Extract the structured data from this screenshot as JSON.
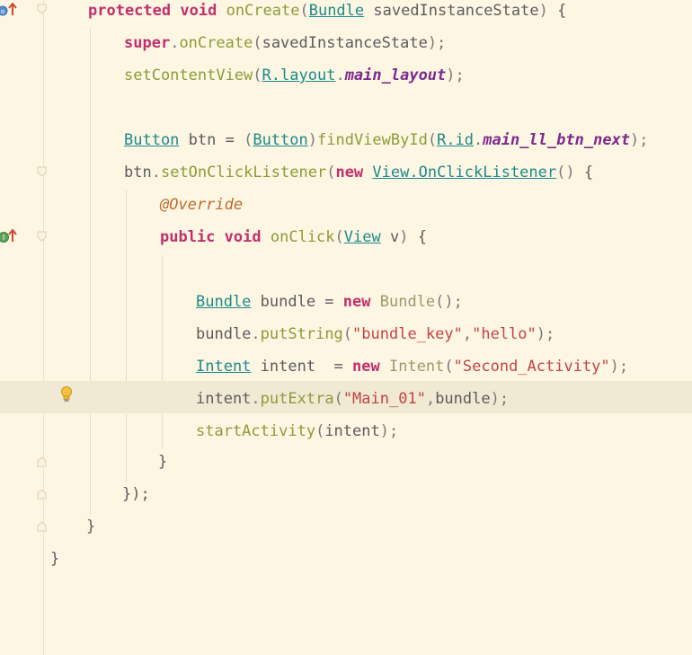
{
  "editor": {
    "lines": [
      {
        "id": "l1",
        "tokens": [
          [
            "kw",
            "protected"
          ],
          [
            "plain",
            " "
          ],
          [
            "kw",
            "void"
          ],
          [
            "plain",
            " "
          ],
          [
            "fn",
            "onCreate"
          ],
          [
            "pn",
            "("
          ],
          [
            "ty",
            "Bundle"
          ],
          [
            "plain",
            " savedInstanceState"
          ],
          [
            "pn",
            ")"
          ],
          [
            "plain",
            " {"
          ]
        ]
      },
      {
        "id": "l2",
        "tokens": [
          [
            "kw",
            "super"
          ],
          [
            "pn",
            "."
          ],
          [
            "fn",
            "onCreate"
          ],
          [
            "pn",
            "("
          ],
          [
            "plain",
            "savedInstanceState"
          ],
          [
            "pn",
            ");"
          ]
        ]
      },
      {
        "id": "l3",
        "tokens": [
          [
            "fn",
            "setContentView"
          ],
          [
            "pn",
            "("
          ],
          [
            "ty",
            "R.layout"
          ],
          [
            "pn",
            "."
          ],
          [
            "cst",
            "main_layout"
          ],
          [
            "pn",
            ");"
          ]
        ]
      },
      {
        "id": "l4",
        "tokens": []
      },
      {
        "id": "l5",
        "tokens": [
          [
            "ty",
            "Button"
          ],
          [
            "plain",
            " btn = "
          ],
          [
            "pn",
            "("
          ],
          [
            "ty",
            "Button"
          ],
          [
            "pn",
            ")"
          ],
          [
            "fn",
            "findViewById"
          ],
          [
            "pn",
            "("
          ],
          [
            "ty",
            "R.id"
          ],
          [
            "pn",
            "."
          ],
          [
            "cst",
            "main_ll_btn_next"
          ],
          [
            "pn",
            ");"
          ]
        ]
      },
      {
        "id": "l6",
        "tokens": [
          [
            "plain",
            "btn"
          ],
          [
            "pn",
            "."
          ],
          [
            "fn",
            "setOnClickListener"
          ],
          [
            "pn",
            "("
          ],
          [
            "kw",
            "new"
          ],
          [
            "plain",
            " "
          ],
          [
            "ty",
            "View.OnClickListener"
          ],
          [
            "pn",
            "()"
          ],
          [
            "plain",
            " {"
          ]
        ]
      },
      {
        "id": "l7",
        "tokens": [
          [
            "ann",
            "@Override"
          ]
        ]
      },
      {
        "id": "l8",
        "tokens": [
          [
            "kw",
            "public"
          ],
          [
            "plain",
            " "
          ],
          [
            "kw",
            "void"
          ],
          [
            "plain",
            " "
          ],
          [
            "fn",
            "onClick"
          ],
          [
            "pn",
            "("
          ],
          [
            "ty",
            "View"
          ],
          [
            "plain",
            " v"
          ],
          [
            "pn",
            ")"
          ],
          [
            "plain",
            " {"
          ]
        ]
      },
      {
        "id": "l9",
        "tokens": []
      },
      {
        "id": "l10",
        "tokens": [
          [
            "ty",
            "Bundle"
          ],
          [
            "plain",
            " bundle = "
          ],
          [
            "kw",
            "new"
          ],
          [
            "plain",
            " "
          ],
          [
            "tyn",
            "Bundle"
          ],
          [
            "pn",
            "();"
          ]
        ]
      },
      {
        "id": "l11",
        "tokens": [
          [
            "plain",
            "bundle"
          ],
          [
            "pn",
            "."
          ],
          [
            "fn",
            "putString"
          ],
          [
            "pn",
            "("
          ],
          [
            "str",
            "\"bundle_key\""
          ],
          [
            "pn",
            ","
          ],
          [
            "str",
            "\"hello\""
          ],
          [
            "pn",
            ");"
          ]
        ]
      },
      {
        "id": "l12",
        "tokens": [
          [
            "ty",
            "Intent"
          ],
          [
            "plain",
            " intent  = "
          ],
          [
            "kw",
            "new"
          ],
          [
            "plain",
            " "
          ],
          [
            "tyn",
            "Intent"
          ],
          [
            "pn",
            "("
          ],
          [
            "str",
            "\"Second_Activity\""
          ],
          [
            "pn",
            ");"
          ]
        ]
      },
      {
        "id": "l13",
        "tokens": [
          [
            "plain",
            "intent"
          ],
          [
            "pn",
            "."
          ],
          [
            "fn",
            "putExtra"
          ],
          [
            "pn",
            "("
          ],
          [
            "str",
            "\"Main_01\""
          ],
          [
            "pn",
            ","
          ],
          [
            "plain",
            "bundle"
          ],
          [
            "pn",
            ");"
          ]
        ]
      },
      {
        "id": "l14",
        "tokens": [
          [
            "fn",
            "startActivity"
          ],
          [
            "pn",
            "("
          ],
          [
            "plain",
            "intent"
          ],
          [
            "pn",
            ");"
          ]
        ]
      },
      {
        "id": "l15",
        "tokens": [
          [
            "plain",
            "}"
          ]
        ]
      },
      {
        "id": "l16",
        "tokens": [
          [
            "plain",
            "});"
          ]
        ]
      },
      {
        "id": "l17",
        "tokens": [
          [
            "plain",
            "}"
          ]
        ]
      },
      {
        "id": "l18",
        "tokens": [
          [
            "plain",
            "}"
          ]
        ]
      }
    ]
  },
  "colors": {
    "background": "#fdf6e3",
    "current_line": "#f0e9d3",
    "keyword": "#c0306b",
    "method": "#8c9c3a",
    "type": "#1d8a8a",
    "constant": "#7c2b8c",
    "string": "#c24444",
    "annotation": "#c26a2b"
  },
  "icons": {
    "override_marker": "override-method-icon",
    "implement_marker": "implements-method-icon",
    "intention": "lightbulb-icon",
    "fold": "fold-marker-icon"
  }
}
